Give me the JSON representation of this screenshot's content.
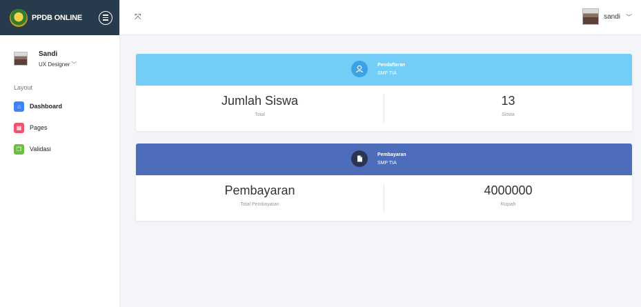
{
  "brand": {
    "title": "PPDB ONLINE"
  },
  "sidebar": {
    "user": {
      "name": "Sandi",
      "role": "UX Designer"
    },
    "section_label": "Layout",
    "items": [
      {
        "label": "Dashboard",
        "icon": "home-icon",
        "color": "#3f83f8",
        "active": true
      },
      {
        "label": "Pages",
        "icon": "grid-icon",
        "color": "#f4516c",
        "active": false
      },
      {
        "label": "Validasi",
        "icon": "chat-icon",
        "color": "#6cbf43",
        "active": false
      }
    ]
  },
  "topbar": {
    "user_name": "sandi"
  },
  "cards": [
    {
      "header_color": "#74cdf7",
      "icon_color": "#3aa3e3",
      "title": "Pendaftaran",
      "subtitle": "SMP TIA",
      "left_value": "Jumlah Siswa",
      "left_caption": "Total",
      "right_value": "13",
      "right_caption": "Siswa"
    },
    {
      "header_color": "#4d6cba",
      "icon_color": "#2b3552",
      "title": "Pembayaran",
      "subtitle": "SMP TIA",
      "left_value": "Pembayaran",
      "left_caption": "Total Pembayaran",
      "right_value": "4000000",
      "right_caption": "Rupiah"
    }
  ]
}
